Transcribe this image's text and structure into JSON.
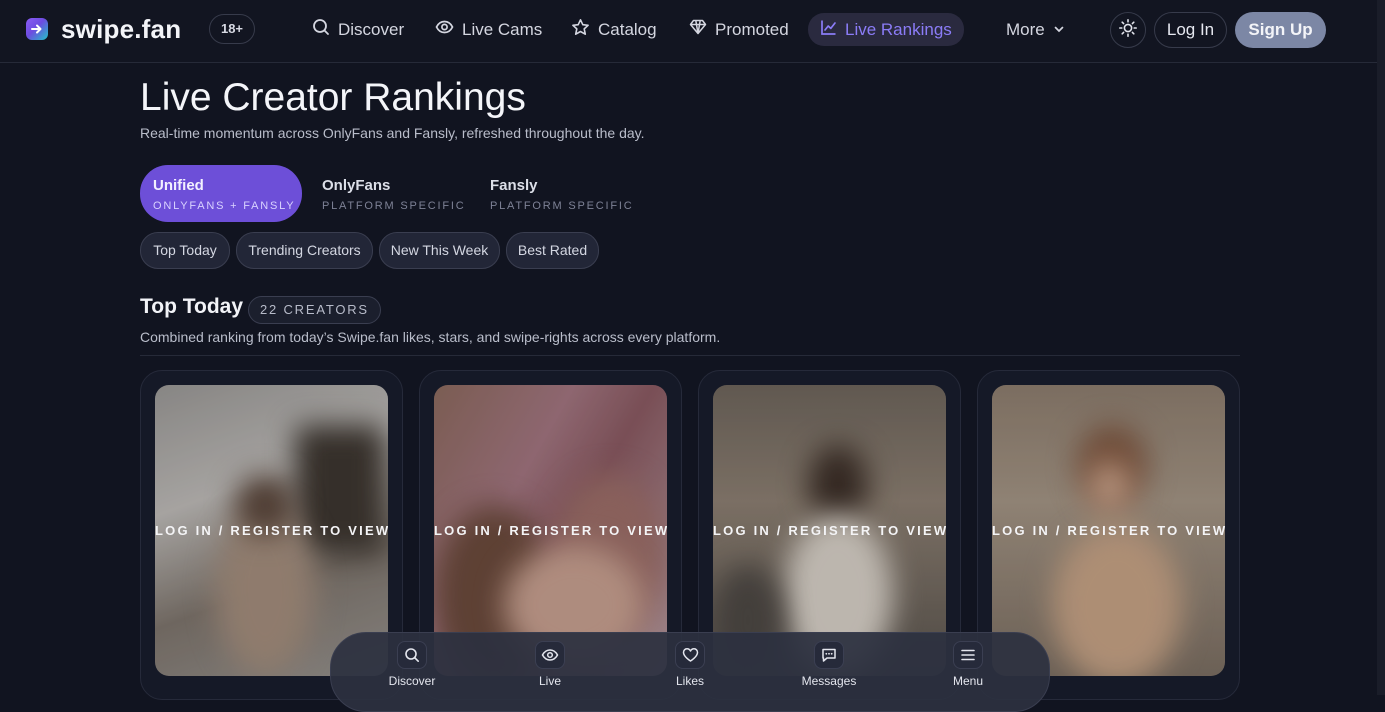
{
  "brand": {
    "name": "swipe.fan",
    "age_badge": "18+"
  },
  "nav": {
    "items": [
      {
        "label": "Discover",
        "icon": "search-icon"
      },
      {
        "label": "Live Cams",
        "icon": "eye-icon"
      },
      {
        "label": "Catalog",
        "icon": "star-icon"
      },
      {
        "label": "Promoted",
        "icon": "diamond-icon"
      },
      {
        "label": "Live Rankings",
        "icon": "chart-icon",
        "active": true
      }
    ],
    "more_label": "More",
    "login_label": "Log In",
    "signup_label": "Sign Up"
  },
  "page": {
    "title": "Live Creator Rankings",
    "subtitle": "Real-time momentum across OnlyFans and Fansly, refreshed throughout the day."
  },
  "platform_tabs": [
    {
      "label": "Unified",
      "sublabel": "ONLYFANS + FANSLY",
      "active": true
    },
    {
      "label": "OnlyFans",
      "sublabel": "PLATFORM SPECIFIC"
    },
    {
      "label": "Fansly",
      "sublabel": "PLATFORM SPECIFIC"
    }
  ],
  "filters": [
    "Top Today",
    "Trending Creators",
    "New This Week",
    "Best Rated"
  ],
  "section": {
    "title": "Top Today",
    "count": "22 CREATORS",
    "description": "Combined ranking from today’s Swipe.fan likes, stars, and swipe-rights across every platform."
  },
  "cards": [
    {
      "overlay_text": "LOG IN / REGISTER TO VIEW"
    },
    {
      "overlay_text": "LOG IN / REGISTER TO VIEW"
    },
    {
      "overlay_text": "LOG IN / REGISTER TO VIEW"
    },
    {
      "overlay_text": "LOG IN / REGISTER TO VIEW"
    }
  ],
  "bottom_nav": [
    {
      "label": "Discover",
      "icon": "search-icon"
    },
    {
      "label": "Live",
      "icon": "eye-icon"
    },
    {
      "label": "Likes",
      "icon": "heart-icon"
    },
    {
      "label": "Messages",
      "icon": "message-icon"
    },
    {
      "label": "Menu",
      "icon": "menu-icon"
    }
  ],
  "colors": {
    "accent": "#6d4fd8",
    "active_nav_text": "#8b7cf7",
    "signup_bg": "#7c87a5",
    "background": "#111420"
  }
}
